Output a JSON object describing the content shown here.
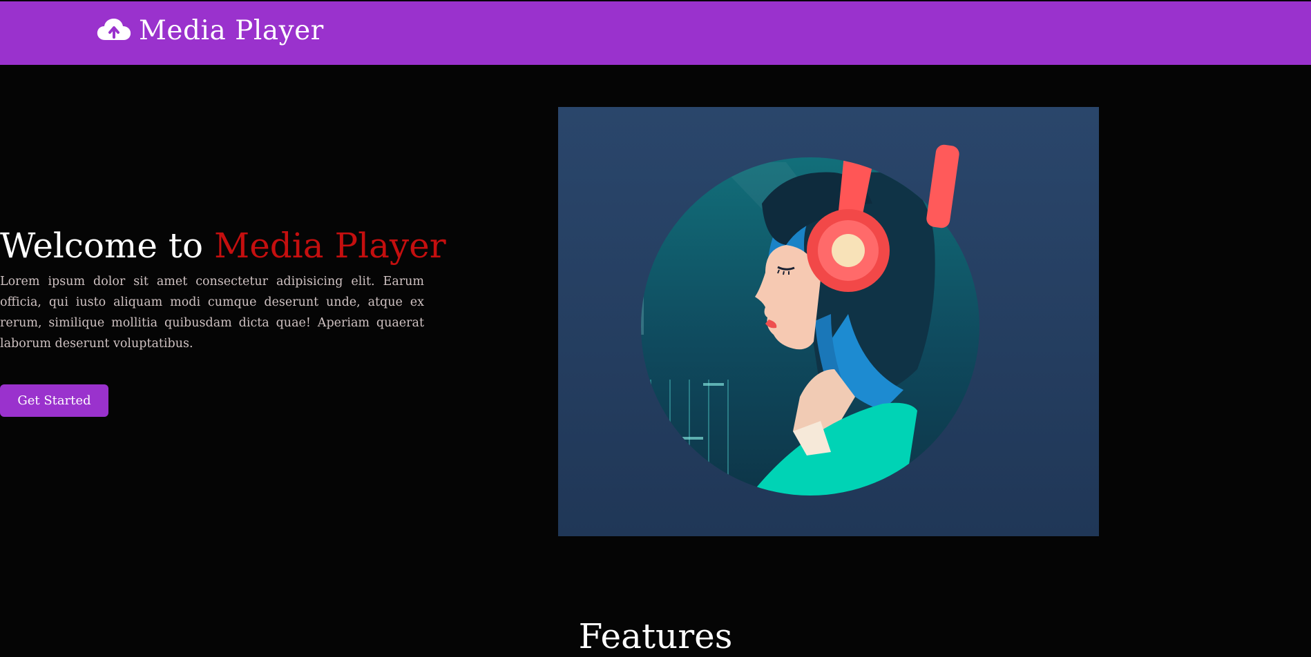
{
  "navbar": {
    "icon": "cloud-upload-icon",
    "title": "Media Player",
    "background": "#9a32cd"
  },
  "hero": {
    "heading_prefix": "Welcome to ",
    "heading_accent": "Media Player",
    "accent_color": "#c40f0f",
    "body": "Lorem ipsum dolor sit amet consectetur adipisicing elit. Earum officia, qui iusto aliquam modi cumque deserunt unde, atque ex rerum, similique mollitia quibusdam dicta quae! Aperiam quaerat laborum deserunt voluptatibus.",
    "cta_label": "Get Started",
    "illustration": "woman-with-headphones-illustration"
  },
  "features": {
    "title": "Features"
  }
}
